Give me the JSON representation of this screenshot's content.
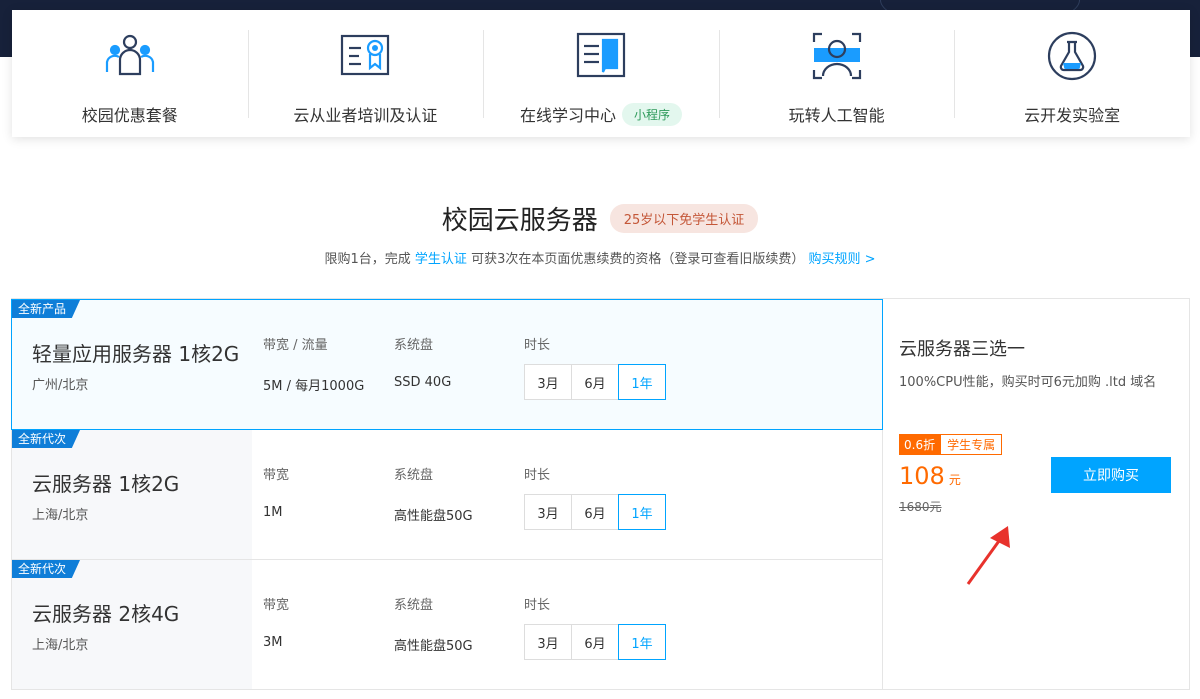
{
  "nav": {
    "items": [
      {
        "label": "校园优惠套餐",
        "icon": "group-users-icon"
      },
      {
        "label": "云从业者培训及认证",
        "icon": "certificate-icon"
      },
      {
        "label": "在线学习中心",
        "icon": "book-icon",
        "tag": "小程序"
      },
      {
        "label": "玩转人工智能",
        "icon": "face-scan-icon"
      },
      {
        "label": "云开发实验室",
        "icon": "flask-icon"
      }
    ]
  },
  "section": {
    "title": "校园云服务器",
    "badge": "25岁以下免学生认证",
    "desc_prefix": "限购1台，完成",
    "desc_link": "学生认证",
    "desc_mid": "可获3次在本页面优惠续费的资格（登录可查看旧版续费）",
    "rules_link": "购买规则 >"
  },
  "products": [
    {
      "ribbon": "全新产品",
      "name": "轻量应用服务器 1核2G",
      "region": "广州/北京",
      "spec1_label": "带宽 / 流量",
      "spec1_value": "5M / 每月1000G",
      "spec2_label": "系统盘",
      "spec2_value": "SSD 40G",
      "duration_label": "时长",
      "durations": [
        "3月",
        "6月",
        "1年"
      ],
      "selected": "1年"
    },
    {
      "ribbon": "全新代次",
      "name": "云服务器 1核2G",
      "region": "上海/北京",
      "spec1_label": "带宽",
      "spec1_value": "1M",
      "spec2_label": "系统盘",
      "spec2_value": "高性能盘50G",
      "duration_label": "时长",
      "durations": [
        "3月",
        "6月",
        "1年"
      ],
      "selected": "1年"
    },
    {
      "ribbon": "全新代次",
      "name": "云服务器 2核4G",
      "region": "上海/北京",
      "spec1_label": "带宽",
      "spec1_value": "3M",
      "spec2_label": "系统盘",
      "spec2_value": "高性能盘50G",
      "duration_label": "时长",
      "durations": [
        "3月",
        "6月",
        "1年"
      ],
      "selected": "1年"
    }
  ],
  "side": {
    "title": "云服务器三选一",
    "desc": "100%CPU性能，购买时可6元加购 .ltd 域名",
    "discount_tag": "0.6折",
    "student_tag": "学生专属",
    "price": "108",
    "price_unit": "元",
    "original_price": "1680元",
    "buy_label": "立即购买"
  },
  "colors": {
    "accent": "#00a4ff",
    "price": "#ff6a00",
    "ribbon": "#0f7ed8",
    "header_band": "#17213a",
    "arrow": "#e8322c"
  }
}
